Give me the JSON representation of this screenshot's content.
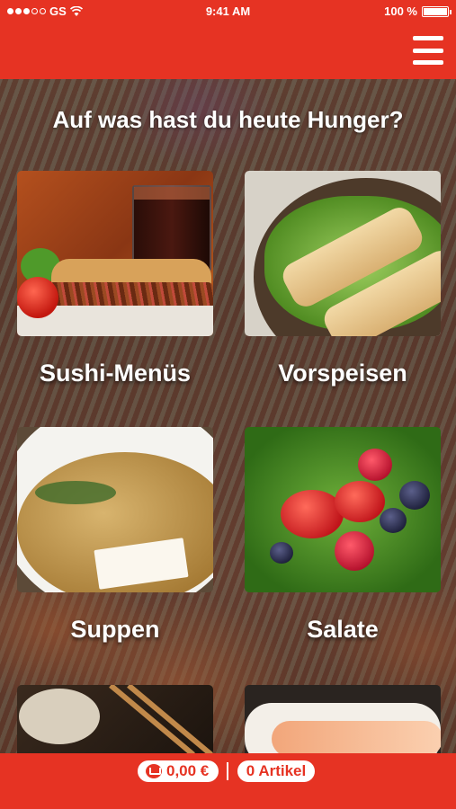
{
  "status_bar": {
    "carrier": "GS",
    "time": "9:41 AM",
    "battery": "100 %"
  },
  "heading": "Auf was hast du heute Hunger?",
  "categories": [
    {
      "label": "Sushi-Menüs"
    },
    {
      "label": "Vorspeisen"
    },
    {
      "label": "Suppen"
    },
    {
      "label": "Salate"
    }
  ],
  "cart": {
    "total": "0,00 €",
    "items": "0 Artikel"
  },
  "colors": {
    "brand": "#e63323"
  },
  "icons": [
    "signal-dots-icon",
    "wifi-icon",
    "battery-icon",
    "menu-icon",
    "cart-icon"
  ]
}
